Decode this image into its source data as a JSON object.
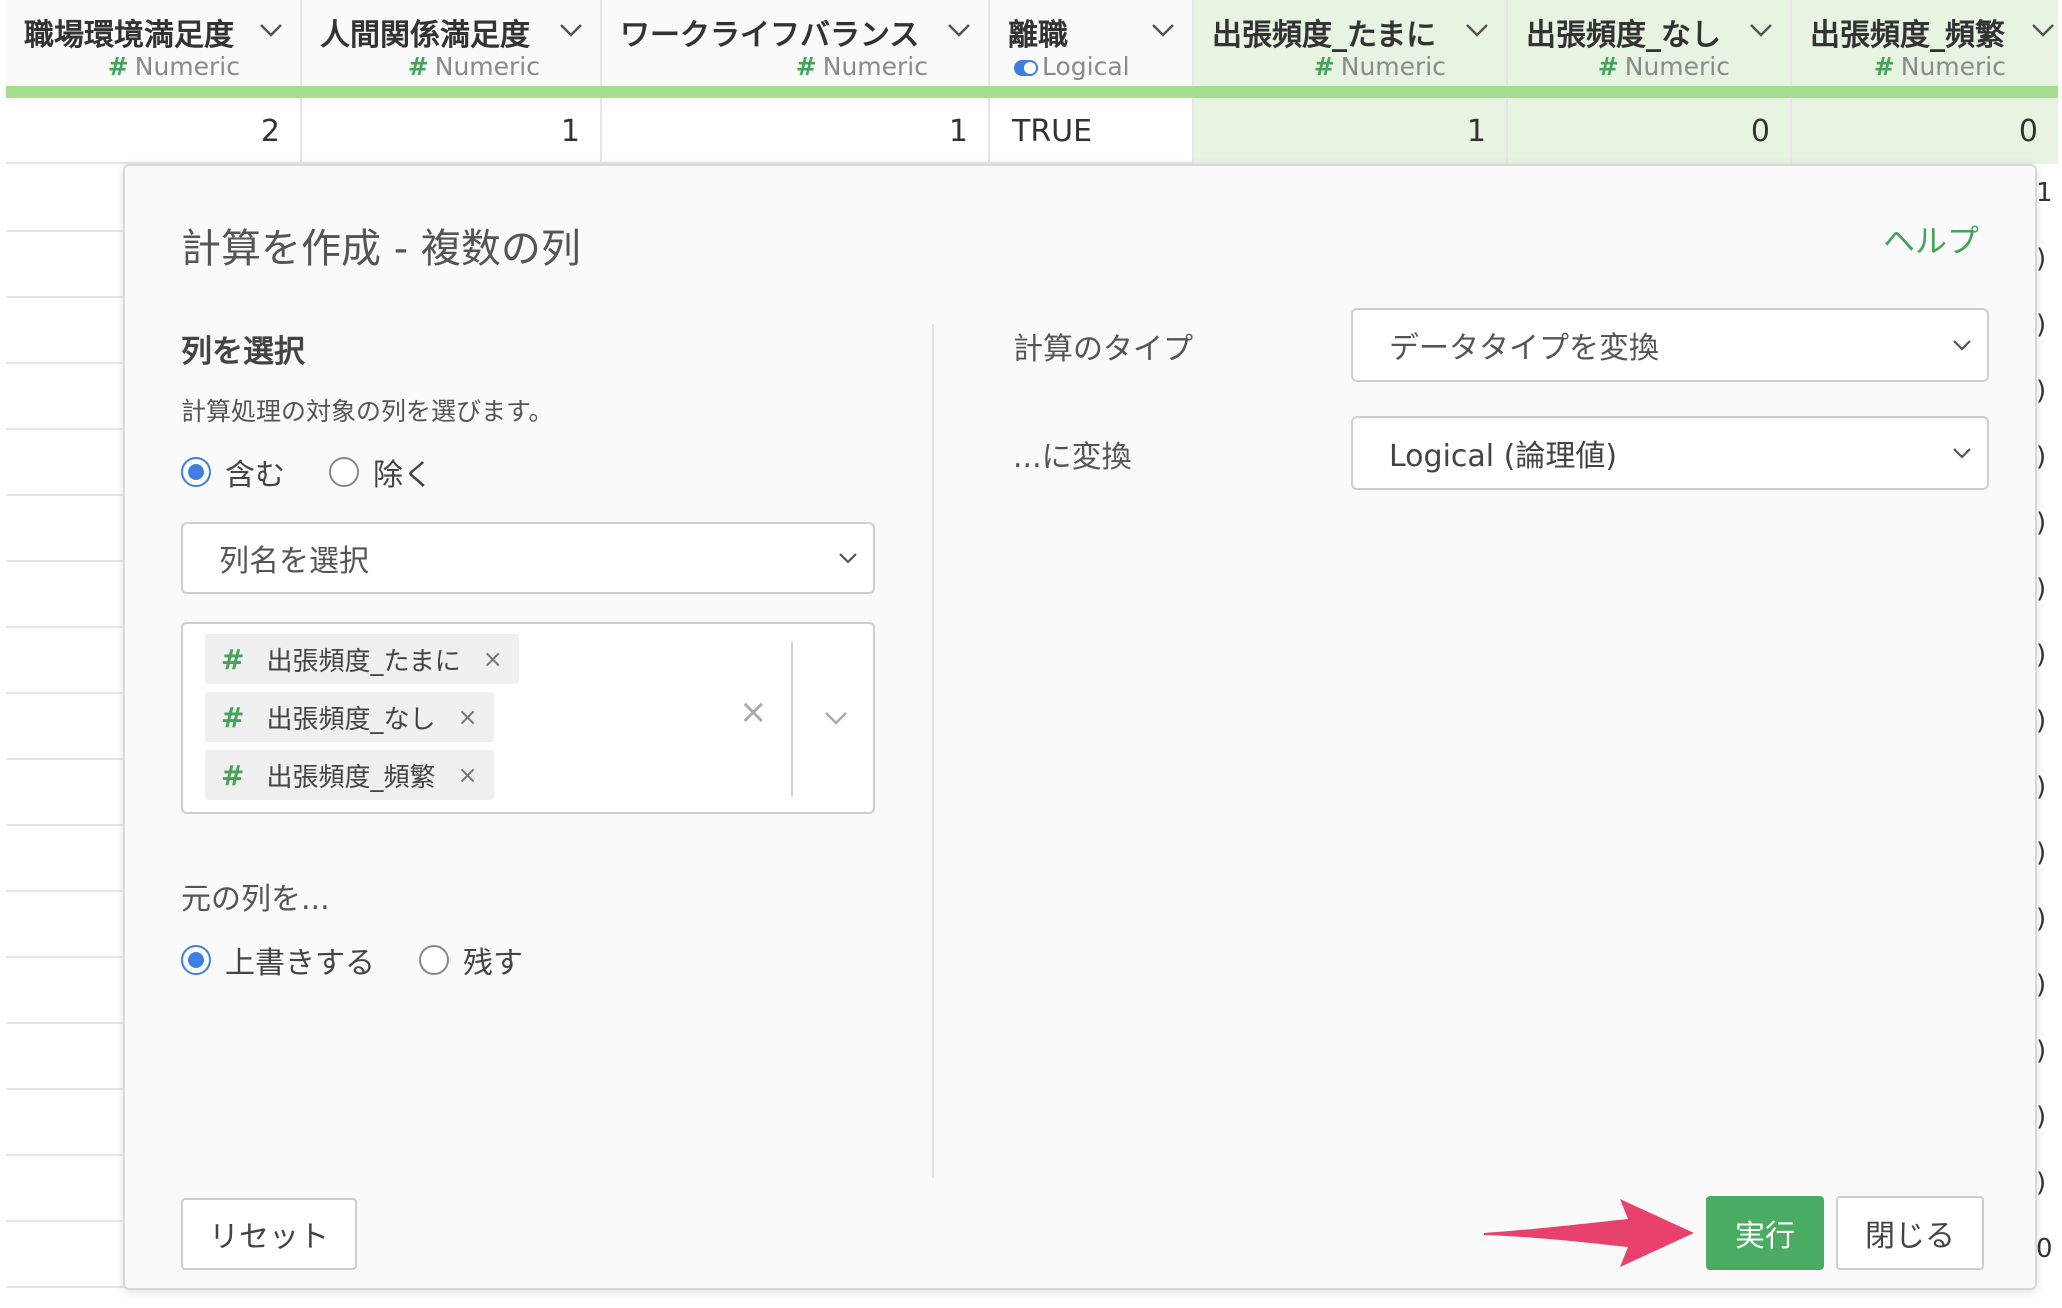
{
  "grid": {
    "columns": [
      {
        "name": "職場環境満足度",
        "type_label": "Numeric",
        "type_icon": "hash-icon",
        "highlighted": false,
        "value": "2"
      },
      {
        "name": "人間関係満足度",
        "type_label": "Numeric",
        "type_icon": "hash-icon",
        "highlighted": false,
        "value": "1"
      },
      {
        "name": "ワークライフバランス",
        "type_label": "Numeric",
        "type_icon": "hash-icon",
        "highlighted": false,
        "value": "1"
      },
      {
        "name": "離職",
        "type_label": "Logical",
        "type_icon": "toggle-icon",
        "highlighted": false,
        "value": "TRUE"
      },
      {
        "name": "出張頻度_たまに",
        "type_label": "Numeric",
        "type_icon": "hash-icon",
        "highlighted": true,
        "value": "1"
      },
      {
        "name": "出張頻度_なし",
        "type_label": "Numeric",
        "type_icon": "hash-icon",
        "highlighted": true,
        "value": "0"
      },
      {
        "name": "出張頻度_頻繁",
        "type_label": "Numeric",
        "type_icon": "hash-icon",
        "highlighted": true,
        "value": "0"
      }
    ],
    "right_edge_glyphs": [
      "1",
      ")",
      ")",
      ")",
      ")",
      ")",
      ")",
      ")",
      ")",
      ")",
      ")",
      ")",
      ")",
      ")",
      ")",
      ")",
      "0"
    ]
  },
  "modal": {
    "title": "計算を作成 - 複数の列",
    "help_label": "ヘルプ",
    "select_columns": {
      "section_title": "列を選択",
      "description": "計算処理の対象の列を選びます。",
      "include_label": "含む",
      "exclude_label": "除く",
      "mode": "include",
      "dropdown_placeholder": "列名を選択",
      "selected_tags": [
        "出張頻度_たまに",
        "出張頻度_なし",
        "出張頻度_頻繁"
      ],
      "tag_icon": "#",
      "remove_glyph": "×",
      "clear_all_glyph": "×"
    },
    "original_columns": {
      "section_title": "元の列を...",
      "overwrite_label": "上書きする",
      "keep_label": "残す",
      "mode": "overwrite"
    },
    "calc_type": {
      "label": "計算のタイプ",
      "value": "データタイプを変換"
    },
    "convert_to": {
      "label": "...に変換",
      "value": "Logical (論理値)"
    },
    "buttons": {
      "reset": "リセット",
      "run": "実行",
      "close": "閉じる"
    }
  },
  "colors": {
    "accent_green": "#4aab63",
    "highlight_bg": "#e7f4e2",
    "header_bar": "#a6de8f",
    "radio_blue": "#3f7fe0",
    "arrow_pink": "#e8416b"
  }
}
